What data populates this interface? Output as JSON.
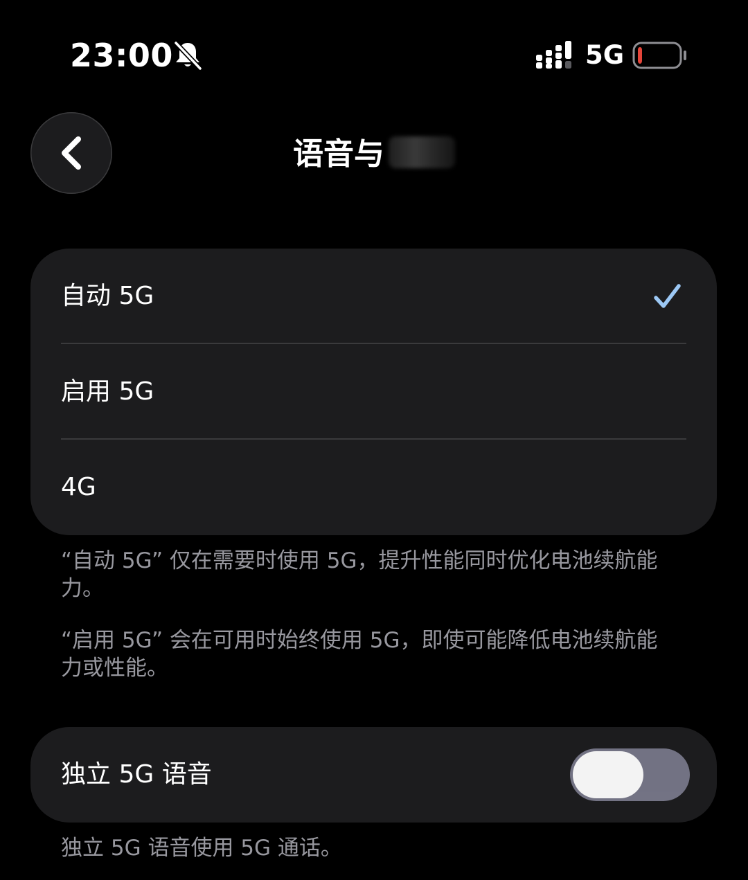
{
  "status_bar": {
    "time": "23:00",
    "network_type": "5G",
    "icons": [
      "bell-slash-icon",
      "cellular-signal-icon",
      "battery-low-icon"
    ],
    "battery_level": 0.1,
    "battery_color": "#e5453a"
  },
  "nav": {
    "back_icon": "chevron-left-icon",
    "title": "语音与"
  },
  "network_options": [
    {
      "label": "自动 5G",
      "selected": true
    },
    {
      "label": "启用 5G",
      "selected": false
    },
    {
      "label": "4G",
      "selected": false
    }
  ],
  "footnotes": {
    "auto_5g": "“自动 5G” 仅在需要时使用 5G，提升性能同时优化电池续航能力。",
    "on_5g": "“启用 5G” 会在可用时始终使用 5G，即使可能降低电池续航能力或性能。"
  },
  "voice": {
    "label": "独立 5G 语音",
    "enabled": false,
    "footnote": "独立 5G 语音使用 5G 通话。"
  },
  "colors": {
    "background": "#000000",
    "group_background": "#1c1c1e",
    "checkmark": "#9cc8f5",
    "secondary_text": "#98989f",
    "toggle_off": "#78788a"
  }
}
